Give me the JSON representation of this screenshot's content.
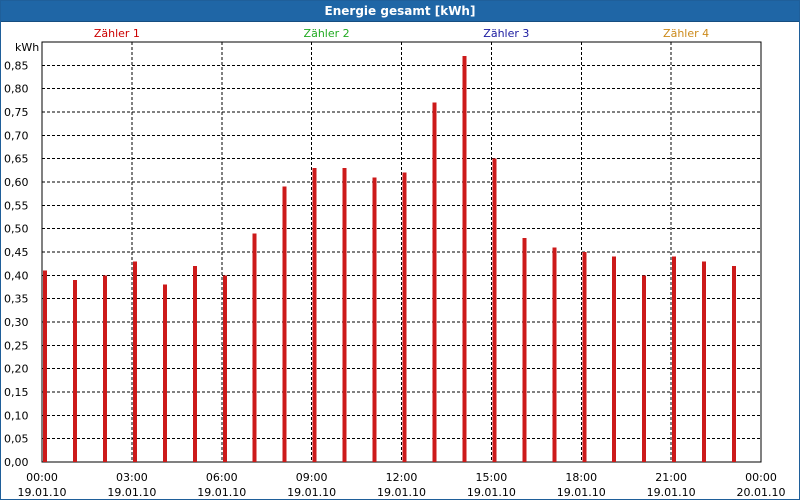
{
  "window": {
    "title": "Energie gesamt [kWh]"
  },
  "colors": {
    "titlebar": "#1f66a6",
    "bar": "#cc1a1a",
    "grid": "#000000",
    "legend": [
      "#cc0000",
      "#22aa22",
      "#1a1aa0",
      "#cc8a1a"
    ]
  },
  "chart_data": {
    "type": "bar",
    "title": "Energie gesamt [kWh]",
    "ylabel": "kWh",
    "ylim": [
      0,
      0.9
    ],
    "yticks": [
      "0,00",
      "0,05",
      "0,10",
      "0,15",
      "0,20",
      "0,25",
      "0,30",
      "0,35",
      "0,40",
      "0,45",
      "0,50",
      "0,55",
      "0,60",
      "0,65",
      "0,70",
      "0,75",
      "0,80",
      "0,85"
    ],
    "xlim_hours": [
      0,
      24
    ],
    "xtick_hours": [
      0,
      3,
      6,
      9,
      12,
      15,
      18,
      21,
      24
    ],
    "xticks": [
      [
        "00:00",
        "19.01.10"
      ],
      [
        "03:00",
        "19.01.10"
      ],
      [
        "06:00",
        "19.01.10"
      ],
      [
        "09:00",
        "19.01.10"
      ],
      [
        "12:00",
        "19.01.10"
      ],
      [
        "15:00",
        "19.01.10"
      ],
      [
        "18:00",
        "19.01.10"
      ],
      [
        "21:00",
        "19.01.10"
      ],
      [
        "00:00",
        "20.01.10"
      ]
    ],
    "legend": [
      "Zähler 1",
      "Zähler 2",
      "Zähler 3",
      "Zähler 4"
    ],
    "grid": true,
    "series": [
      {
        "hours": [
          0,
          1,
          2,
          3,
          4,
          5,
          6,
          7,
          8,
          9,
          10,
          11,
          12,
          13,
          14,
          15,
          16,
          17,
          18,
          19,
          20,
          21,
          22,
          23
        ],
        "values": [
          0.41,
          0.39,
          0.4,
          0.43,
          0.38,
          0.42,
          0.4,
          0.49,
          0.59,
          0.63,
          0.63,
          0.61,
          0.62,
          0.77,
          0.87,
          0.65,
          0.48,
          0.46,
          0.45,
          0.44,
          0.4,
          0.44,
          0.43,
          0.42
        ]
      }
    ]
  }
}
